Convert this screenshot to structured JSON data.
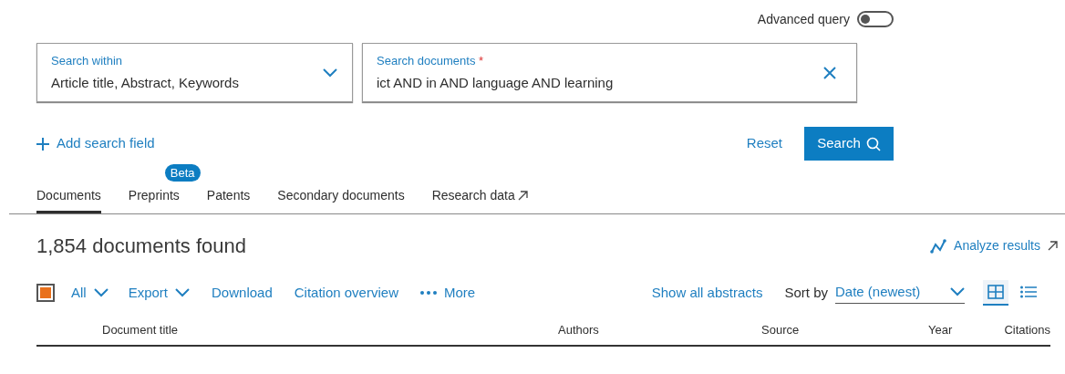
{
  "advanced_query": {
    "label": "Advanced query",
    "on": false
  },
  "search_within": {
    "label": "Search within",
    "value": "Article title, Abstract, Keywords"
  },
  "search_documents": {
    "label": "Search documents",
    "required_mark": "*",
    "value": "ict AND in AND language AND learning"
  },
  "add_field": "Add search field",
  "reset": "Reset",
  "search_button": "Search",
  "tabs": [
    {
      "label": "Documents",
      "selected": true
    },
    {
      "label": "Preprints",
      "selected": false,
      "badge": "Beta"
    },
    {
      "label": "Patents",
      "selected": false
    },
    {
      "label": "Secondary documents",
      "selected": false
    },
    {
      "label": "Research data",
      "selected": false,
      "external": true
    }
  ],
  "results_count": "1,854 documents found",
  "analyze": "Analyze results",
  "select_all": {
    "partial": true,
    "label": "All"
  },
  "actions": [
    {
      "label": "Export",
      "kind": "dropdown"
    },
    {
      "label": "Download",
      "kind": "link"
    },
    {
      "label": "Citation overview",
      "kind": "link"
    },
    {
      "label": "More",
      "kind": "more"
    }
  ],
  "show_abstracts": "Show all abstracts",
  "sort": {
    "label": "Sort by",
    "value": "Date (newest)"
  },
  "view_modes": [
    {
      "kind": "grid",
      "selected": true
    },
    {
      "kind": "list",
      "selected": false
    }
  ],
  "table": {
    "columns": [
      "Document title",
      "Authors",
      "Source",
      "Year",
      "Citations"
    ]
  }
}
